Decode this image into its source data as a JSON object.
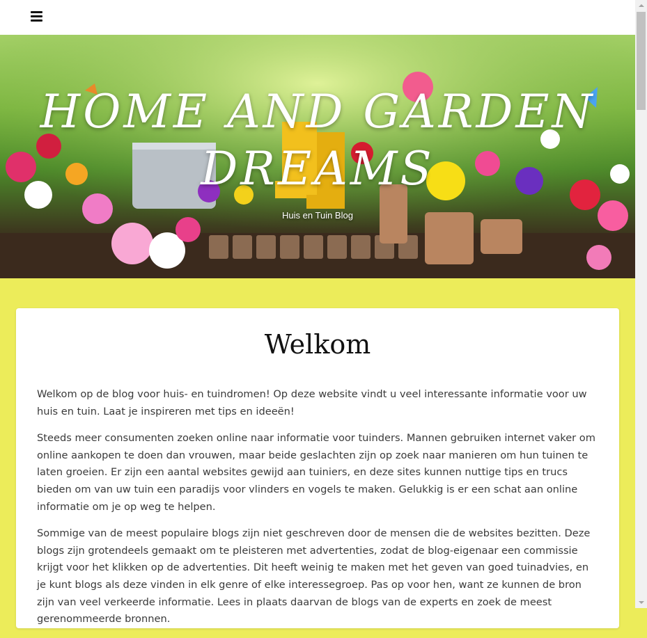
{
  "header": {
    "menu_icon": "hamburger-menu-icon"
  },
  "hero": {
    "title": "HOME AND GARDEN DREAMS",
    "tagline": "Huis en Tuin Blog"
  },
  "main": {
    "heading": "Welkom",
    "paragraphs": [
      "Welkom op de blog voor huis- en tuindromen! Op deze website vindt u veel interessante informatie voor uw huis en tuin. Laat je inspireren met tips en ideeën!",
      "Steeds meer consumenten zoeken online naar informatie voor tuinders. Mannen gebruiken internet vaker om online aankopen te doen dan vrouwen, maar beide geslachten zijn op zoek naar manieren om hun tuinen te laten groeien. Er zijn een aantal websites gewijd aan tuiniers, en deze sites kunnen nuttige tips en trucs bieden om van uw tuin een paradijs voor vlinders en vogels te maken. Gelukkig is er een schat aan online informatie om je op weg te helpen.",
      "Sommige van de meest populaire blogs zijn niet geschreven door de mensen die de websites bezitten. Deze blogs zijn grotendeels gemaakt om te pleisteren met advertenties, zodat de blog-eigenaar een commissie krijgt voor het klikken op de advertenties. Dit heeft weinig te maken met het geven van goed tuinadvies, en je kunt blogs als deze vinden in elk genre of elke interessegroep. Pas op voor hen, want ze kunnen de bron zijn van veel verkeerde informatie. Lees in plaats daarvan de blogs van de experts en zoek de meest gerenommeerde bronnen."
    ]
  },
  "colors": {
    "page_background": "#ecec5a",
    "card_background": "#ffffff",
    "text": "#3a3a3a"
  }
}
